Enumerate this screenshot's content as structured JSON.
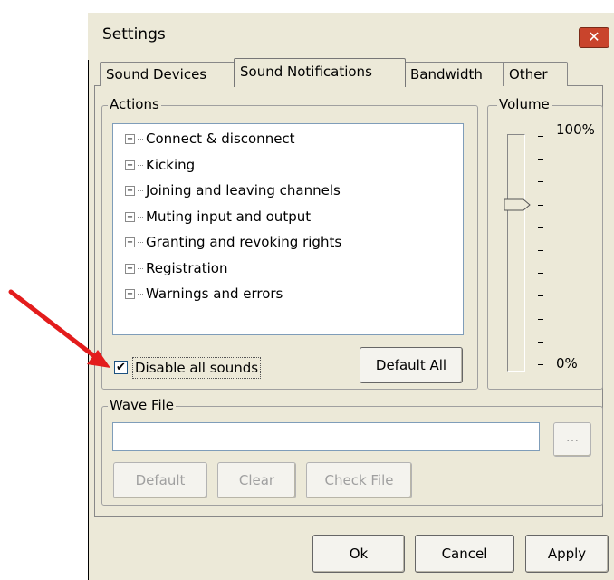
{
  "window": {
    "title": "Settings",
    "close_icon": "close-icon"
  },
  "tabs": [
    {
      "label": "Sound Devices"
    },
    {
      "label": "Sound Notifications",
      "active": true
    },
    {
      "label": "Bandwidth"
    },
    {
      "label": "Other"
    }
  ],
  "actions": {
    "group_label": "Actions",
    "items": [
      "Connect & disconnect",
      "Kicking",
      "Joining and leaving  channels",
      "Muting input and output",
      "Granting and revoking rights",
      "Registration",
      "Warnings and errors"
    ],
    "disable_all_sounds_label": "Disable all sounds",
    "disable_all_sounds_checked": true,
    "default_all_label": "Default All"
  },
  "volume": {
    "group_label": "Volume",
    "max_label": "100%",
    "min_label": "0%",
    "level_fraction": 0.7
  },
  "wave_file": {
    "group_label": "Wave File",
    "value": "",
    "browse_label": "...",
    "default_label": "Default",
    "clear_label": "Clear",
    "check_file_label": "Check File"
  },
  "footer": {
    "ok_label": "Ok",
    "cancel_label": "Cancel",
    "apply_label": "Apply"
  },
  "annotation": {
    "arrow_color": "#e31c1c"
  }
}
